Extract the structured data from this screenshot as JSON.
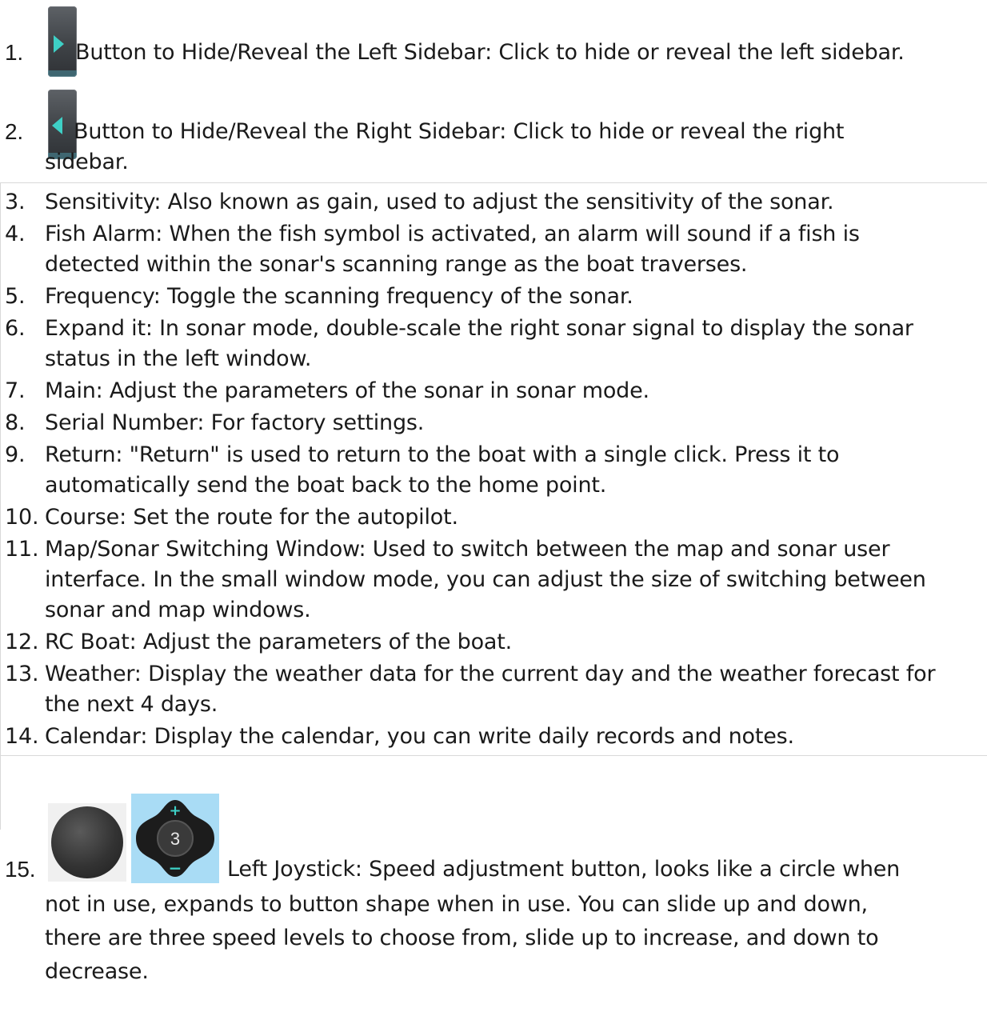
{
  "items": [
    {
      "num": "1.",
      "lines": [
        "Button to Hide/Reveal the Left Sidebar: Click to hide or reveal the left sidebar."
      ]
    },
    {
      "num": "2.",
      "lines": [
        "Button to Hide/Reveal the Right Sidebar: Click to hide or reveal the right",
        "sidebar."
      ]
    },
    {
      "num": "3.",
      "lines": [
        "Sensitivity: Also known as gain, used to adjust the sensitivity of the sonar."
      ]
    },
    {
      "num": "4.",
      "lines": [
        "Fish Alarm: When the fish symbol is activated, an alarm will sound if a fish is",
        "detected within the sonar's scanning range as the boat traverses."
      ]
    },
    {
      "num": "5.",
      "lines": [
        "Frequency: Toggle the scanning frequency of the sonar."
      ]
    },
    {
      "num": "6.",
      "lines": [
        "Expand it: In sonar mode, double-scale the right sonar signal to display the sonar",
        "status in the left window."
      ]
    },
    {
      "num": "7.",
      "lines": [
        "Main: Adjust the parameters of the sonar in sonar mode."
      ]
    },
    {
      "num": "8.",
      "lines": [
        "Serial Number: For factory settings."
      ]
    },
    {
      "num": "9.",
      "lines": [
        "Return: \"Return\" is used to return to the boat with a single click. Press it to",
        "automatically send the boat back to the home point."
      ]
    },
    {
      "num": "10.",
      "lines": [
        "Course: Set the route for the autopilot."
      ]
    },
    {
      "num": "11.",
      "lines": [
        "Map/Sonar Switching Window: Used to switch between the map and sonar user",
        "interface. In the small window mode, you can adjust the size of switching between",
        "sonar and map windows."
      ]
    },
    {
      "num": "12.",
      "lines": [
        "RC Boat: Adjust the parameters of the boat."
      ]
    },
    {
      "num": "13.",
      "lines": [
        "Weather: Display the weather data for the current day and the weather forecast for",
        "the next 4 days."
      ]
    },
    {
      "num": "14.",
      "lines": [
        "Calendar: Display the calendar, you can write daily records and notes."
      ]
    },
    {
      "num": "15.",
      "lines": [
        "Left Joystick: Speed adjustment button, looks like a circle when",
        "not in use, expands to button shape when in use. You can slide up and down,",
        "there are three speed levels to choose from, slide up to increase, and down to",
        "decrease."
      ]
    }
  ],
  "joystick_speed_value": "3",
  "joystick_plus": "+",
  "joystick_minus": "−",
  "colors": {
    "toggle_arrow": "#3ed0c6",
    "dpad_background": "#a9dcf5",
    "divider": "#d9d9d9"
  },
  "icons": [
    "right-arrow-toggle-icon",
    "left-arrow-toggle-icon",
    "joystick-circle-icon",
    "joystick-dpad-icon"
  ]
}
